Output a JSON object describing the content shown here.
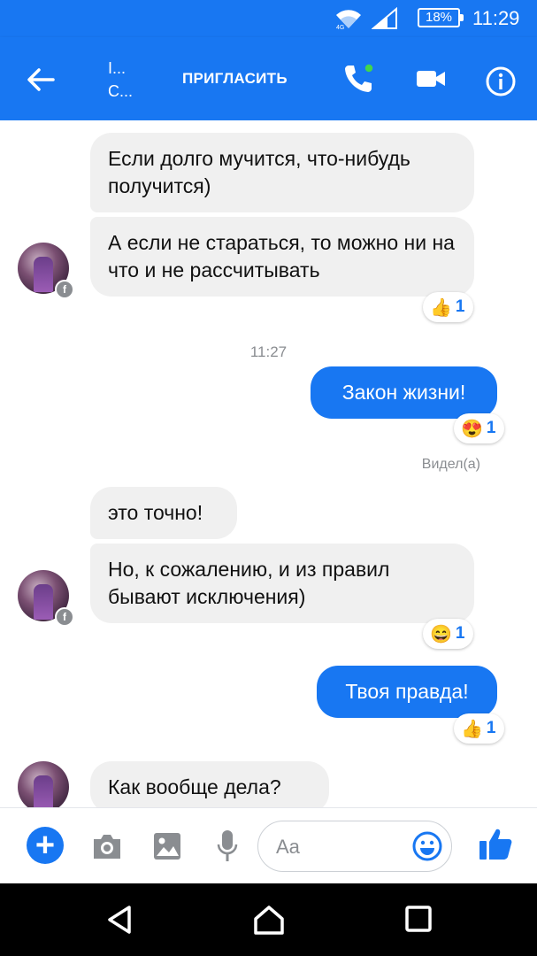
{
  "status_bar": {
    "time": "11:29",
    "battery": "18%"
  },
  "header": {
    "name_line1": "I...",
    "name_line2": "C...",
    "invite_label": "ПРИГЛАСИТЬ",
    "icons": [
      "back-arrow-icon",
      "phone-icon",
      "video-camera-icon",
      "info-icon"
    ]
  },
  "messages": [
    {
      "text": "Если долго мучится, что-нибудь получится)",
      "direction": "incoming"
    },
    {
      "text": "А если не стараться, то можно ни на что и не рассчитывать",
      "direction": "incoming",
      "reaction": {
        "emoji": "👍",
        "count": "1"
      }
    },
    {
      "timestamp": "11:27"
    },
    {
      "text": "Закон жизни!",
      "direction": "outgoing",
      "reaction": {
        "emoji": "😍",
        "count": "1"
      }
    },
    {
      "seen": "Видел(а)"
    },
    {
      "text": "это точно!",
      "direction": "incoming"
    },
    {
      "text": "Но, к сожалению, и из правил бывают исключения)",
      "direction": "incoming",
      "reaction": {
        "emoji": "😄",
        "count": "1"
      }
    },
    {
      "text": "Твоя правда!",
      "direction": "outgoing",
      "reaction": {
        "emoji": "👍",
        "count": "1"
      }
    },
    {
      "text": "Как вообще дела?",
      "direction": "incoming"
    }
  ],
  "composer": {
    "placeholder": "Aa",
    "icons": [
      "plus-icon",
      "camera-icon",
      "image-icon",
      "microphone-icon",
      "emoji-icon",
      "thumbs-up-icon"
    ]
  },
  "colors": {
    "accent": "#1877f2",
    "incoming_bubble": "#f0f0f0",
    "muted_text": "#8a8d91"
  }
}
